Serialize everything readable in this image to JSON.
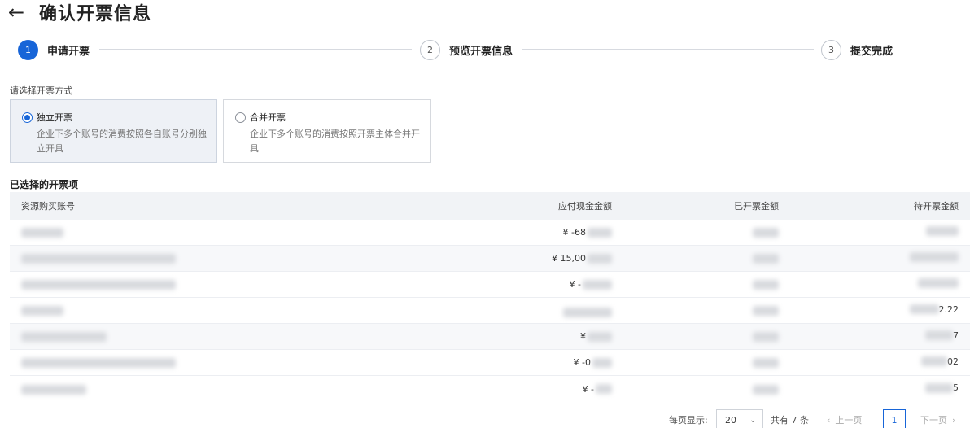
{
  "header": {
    "back_icon": "←",
    "title": "确认开票信息"
  },
  "steps": [
    {
      "num": "1",
      "label": "申请开票",
      "state": "active"
    },
    {
      "num": "2",
      "label": "预览开票信息",
      "state": "pending"
    },
    {
      "num": "3",
      "label": "提交完成",
      "state": "pending"
    }
  ],
  "method": {
    "label": "请选择开票方式",
    "options": [
      {
        "title": "独立开票",
        "desc": "企业下多个账号的消费按照各自账号分别独立开具",
        "selected": true
      },
      {
        "title": "合并开票",
        "desc": "企业下多个账号的消费按照开票主体合并开具",
        "selected": false
      }
    ]
  },
  "table": {
    "title": "已选择的开票项",
    "columns": [
      "资源购买账号",
      "应付现金金额",
      "已开票金额",
      "待开票金额"
    ],
    "rows": [
      {
        "payable": "¥ -68",
        "pending": ""
      },
      {
        "payable": "¥ 15,00",
        "pending": ""
      },
      {
        "payable": "¥ -",
        "pending": ""
      },
      {
        "payable": "",
        "pending": "2.22"
      },
      {
        "payable": "¥",
        "pending": "7"
      },
      {
        "payable": "¥ -0",
        "pending": "02"
      },
      {
        "payable": "¥ -",
        "pending": "5"
      }
    ]
  },
  "pagination": {
    "per_page_label": "每页显示:",
    "per_page": "20",
    "total": "共有 7 条",
    "prev": "上一页",
    "current": "1",
    "next": "下一页"
  },
  "colors": {
    "accent": "#1765d8"
  }
}
